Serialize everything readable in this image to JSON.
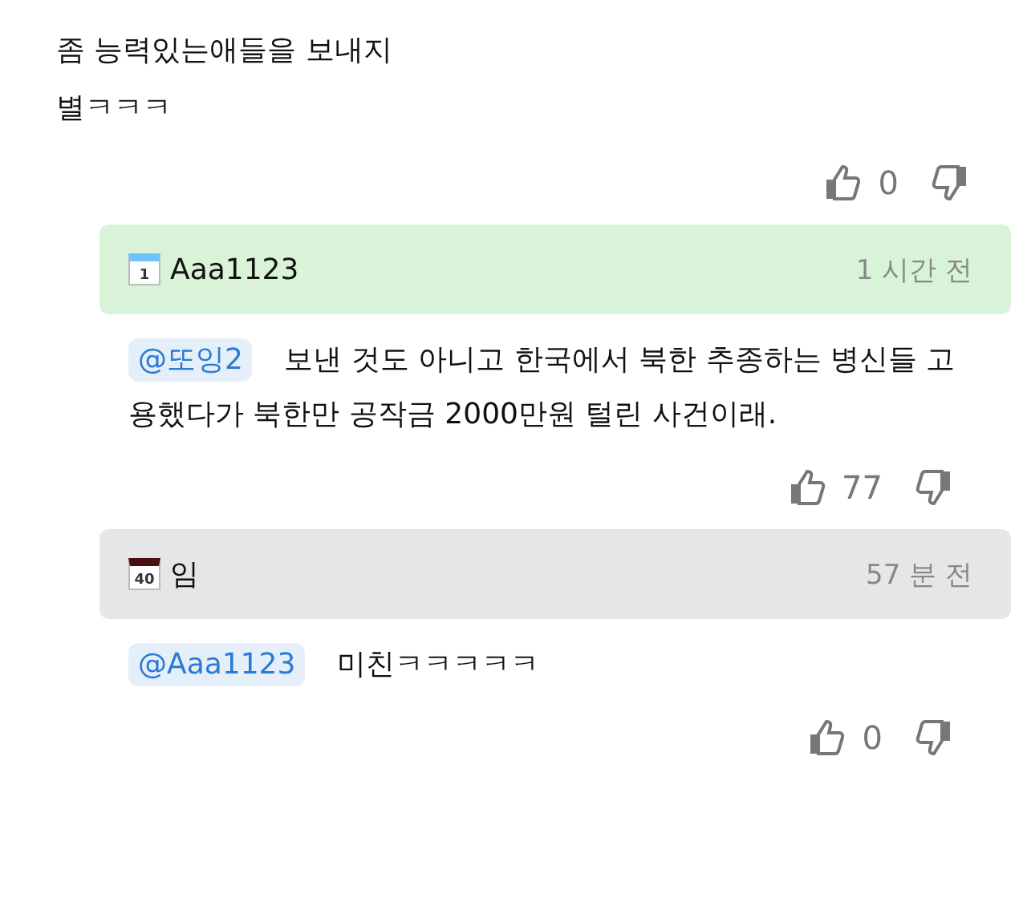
{
  "comment": {
    "lines": [
      "좀 능력있는애들을 보내지",
      "별ㅋㅋㅋ"
    ],
    "likes": "0"
  },
  "replies": [
    {
      "badge": {
        "label": "1",
        "color": "#6cc3ff"
      },
      "name": "Aaa1123",
      "time": "1 시간 전",
      "color": "#d9f3d9",
      "mention": "@또잉2",
      "text": "보낸 것도 아니고 한국에서 북한 추종하는 병신들 고용했다가 북한만 공작금 2000만원 털린 사건이래.",
      "likes": "77"
    },
    {
      "badge": {
        "label": "40",
        "color": "#4a1010"
      },
      "name": "임",
      "time": "57 분 전",
      "color": "#e6e6e6",
      "mention": "@Aaa1123",
      "text": "미친ㅋㅋㅋㅋㅋ",
      "likes": "0"
    }
  ]
}
